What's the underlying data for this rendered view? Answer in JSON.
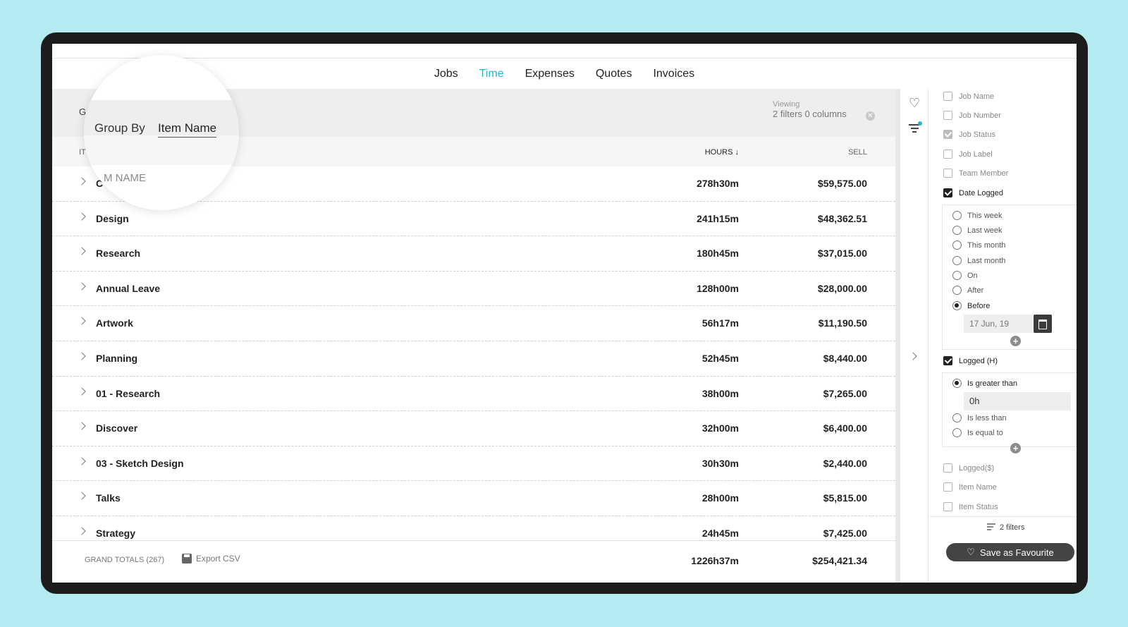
{
  "nav": {
    "tabs": [
      "Jobs",
      "Time",
      "Expenses",
      "Quotes",
      "Invoices"
    ],
    "active": "Time"
  },
  "groupbar": {
    "label_partial": "G",
    "group_by_label": "Group By",
    "group_by_value": "Item Name"
  },
  "viewing": {
    "label": "Viewing",
    "summary": "2 filters 0 columns"
  },
  "table": {
    "col_item_partial": "IT",
    "col_item_zoom": "M NAME",
    "col_hours": "HOURS",
    "col_sell": "SELL",
    "rows": [
      {
        "name": "C",
        "hours": "278h30m",
        "sell": "$59,575.00"
      },
      {
        "name": "Design",
        "hours": "241h15m",
        "sell": "$48,362.51"
      },
      {
        "name": "Research",
        "hours": "180h45m",
        "sell": "$37,015.00"
      },
      {
        "name": "Annual Leave",
        "hours": "128h00m",
        "sell": "$28,000.00"
      },
      {
        "name": "Artwork",
        "hours": "56h17m",
        "sell": "$11,190.50"
      },
      {
        "name": "Planning",
        "hours": "52h45m",
        "sell": "$8,440.00"
      },
      {
        "name": "01 - Research",
        "hours": "38h00m",
        "sell": "$7,265.00"
      },
      {
        "name": "Discover",
        "hours": "32h00m",
        "sell": "$6,400.00"
      },
      {
        "name": "03 - Sketch Design",
        "hours": "30h30m",
        "sell": "$2,440.00"
      },
      {
        "name": "Talks",
        "hours": "28h00m",
        "sell": "$5,815.00"
      },
      {
        "name": "Strategy",
        "hours": "24h45m",
        "sell": "$7,425.00"
      }
    ],
    "totals": {
      "label": "GRAND TOTALS (267)",
      "export": "Export CSV",
      "hours": "1226h37m",
      "sell": "$254,421.34"
    }
  },
  "filters": {
    "job_name": "Job Name",
    "job_number": "Job Number",
    "job_status": "Job Status",
    "job_label": "Job Label",
    "team_member": "Team Member",
    "date_logged": "Date Logged",
    "date_options": [
      "This week",
      "Last week",
      "This month",
      "Last month",
      "On",
      "After",
      "Before"
    ],
    "date_value": "17 Jun, 19",
    "logged_h": "Logged (H)",
    "logged_h_options": {
      "gt": "Is greater than",
      "lt": "Is less than",
      "eq": "Is equal to"
    },
    "logged_h_value": "0h",
    "logged_s": "Logged($)",
    "item_name": "Item Name",
    "item_status": "Item Status",
    "filter_count": "2 filters",
    "save_favourite": "Save as Favourite"
  },
  "colors": {
    "accent": "#2ab3c9",
    "background": "#b3ebf0",
    "device": "#1c1c1c"
  }
}
